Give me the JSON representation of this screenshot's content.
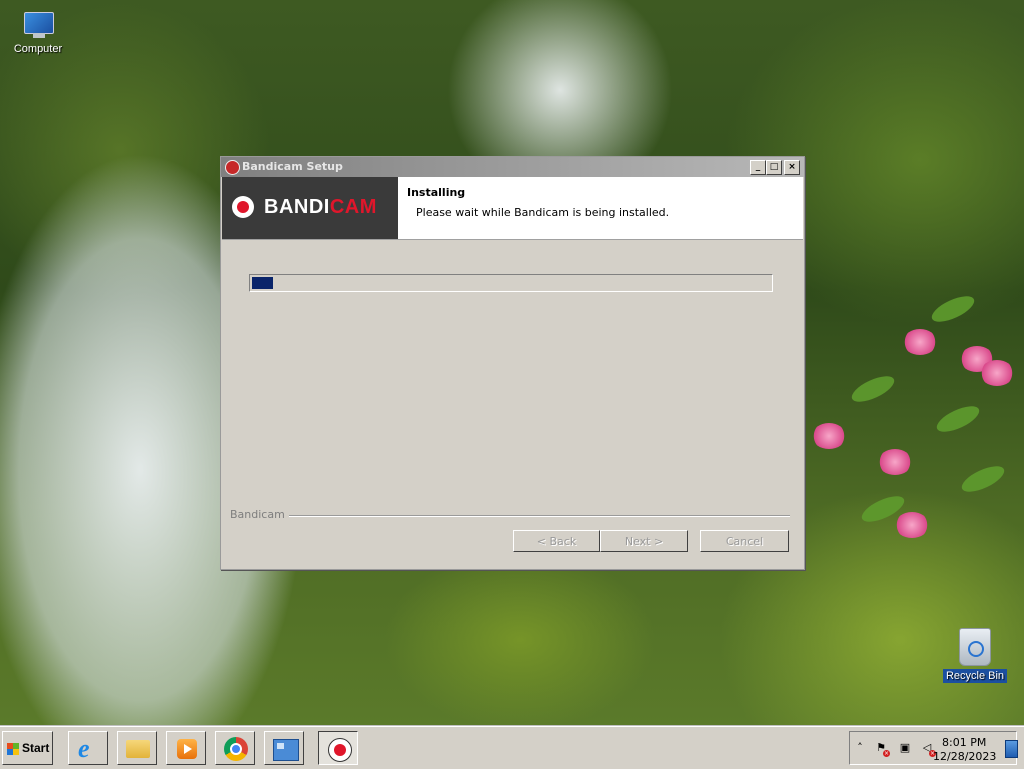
{
  "desktop": {
    "icons": [
      {
        "label": "Computer"
      },
      {
        "label": "Recycle Bin"
      }
    ]
  },
  "window": {
    "title": "Bandicam Setup",
    "controls": {
      "minimize": "_",
      "maximize": "□",
      "close": "×"
    },
    "logo": {
      "part1": "BANDI",
      "part2": "CAM"
    },
    "header": {
      "title": "Installing",
      "subtitle": "Please wait while Bandicam is being installed."
    },
    "progress": {
      "fraction": 0.04
    },
    "footer_label": "Bandicam",
    "buttons": {
      "back": "< Back",
      "next": "Next >",
      "cancel": "Cancel"
    }
  },
  "taskbar": {
    "start_label": "Start",
    "apps": [
      {
        "name": "internet-explorer-icon"
      },
      {
        "name": "file-explorer-icon"
      },
      {
        "name": "media-player-icon"
      },
      {
        "name": "chrome-icon"
      },
      {
        "name": "control-panel-icon"
      },
      {
        "name": "bandicam-setup-icon"
      }
    ],
    "tray": {
      "expand": "˄",
      "time": "8:01 PM",
      "date": "12/28/2023"
    }
  },
  "colors": {
    "progress_fill": "#0a246a",
    "brand_red": "#e0162b",
    "logo_bg": "#3a3a3a"
  }
}
